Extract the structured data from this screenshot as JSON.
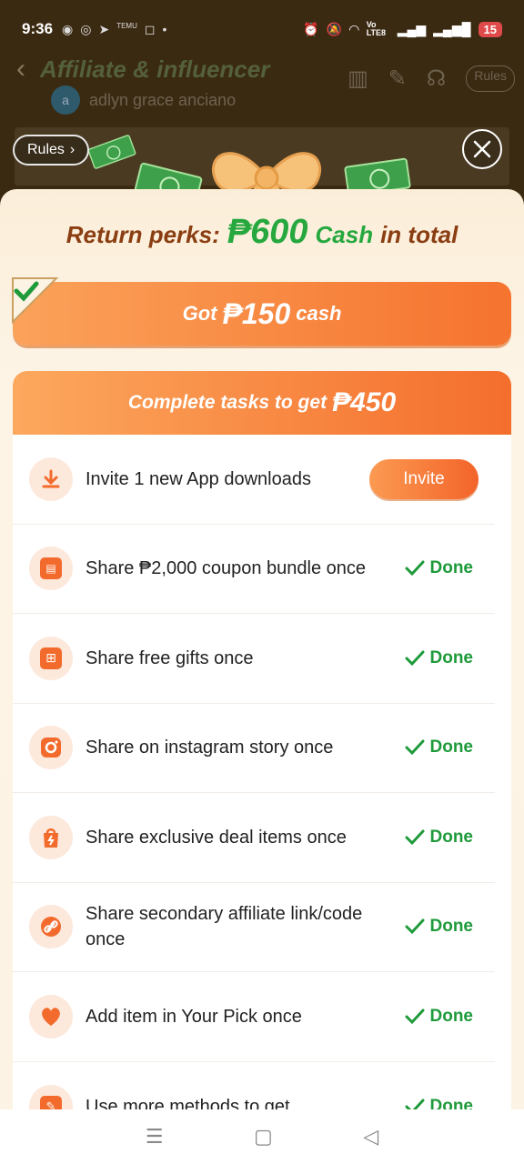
{
  "status_bar": {
    "time": "9:36",
    "left_icons": [
      "discord-icon",
      "messenger-icon",
      "telegram-icon",
      "temu-icon",
      "instagram-icon"
    ],
    "temu_label": "TEMU",
    "network_label": "Vo LTE8",
    "battery": "15"
  },
  "background_app": {
    "title": "Affiliate & influencer",
    "avatar_letter": "a",
    "username": "adlyn grace anciano",
    "rules_right": "Rules"
  },
  "overlay": {
    "rules_label": "Rules"
  },
  "modal": {
    "perks_prefix": "Return perks:",
    "perks_amount": "₱600",
    "perks_cash": "Cash",
    "perks_suffix": "in total",
    "got_prefix": "Got",
    "got_amount": "₱150",
    "got_suffix": "cash",
    "tasks_prefix": "Complete tasks to get",
    "tasks_amount": "₱450",
    "tasks": [
      {
        "icon": "download-icon",
        "text": "Invite 1 new App downloads",
        "action": "invite",
        "action_label": "Invite"
      },
      {
        "icon": "coupon-icon",
        "text": "Share ₱2,000 coupon bundle once",
        "action": "done",
        "action_label": "Done"
      },
      {
        "icon": "gift-icon",
        "text": "Share free gifts once",
        "action": "done",
        "action_label": "Done"
      },
      {
        "icon": "instagram-icon",
        "text": "Share on instagram story once",
        "action": "done",
        "action_label": "Done"
      },
      {
        "icon": "shopping-bag-icon",
        "text": "Share exclusive deal items once",
        "action": "done",
        "action_label": "Done"
      },
      {
        "icon": "link-icon",
        "text": "Share secondary affiliate link/code once",
        "action": "done",
        "action_label": "Done"
      },
      {
        "icon": "heart-icon",
        "text": "Add item in Your Pick once",
        "action": "done",
        "action_label": "Done"
      },
      {
        "icon": "edit-icon",
        "text": "Use more methods to get",
        "action": "done",
        "action_label": "Done"
      }
    ]
  },
  "colors": {
    "accent_orange": "#f46e2c",
    "done_green": "#1e9a3a",
    "cash_green": "#26a83e",
    "title_brown": "#8a3e12"
  }
}
